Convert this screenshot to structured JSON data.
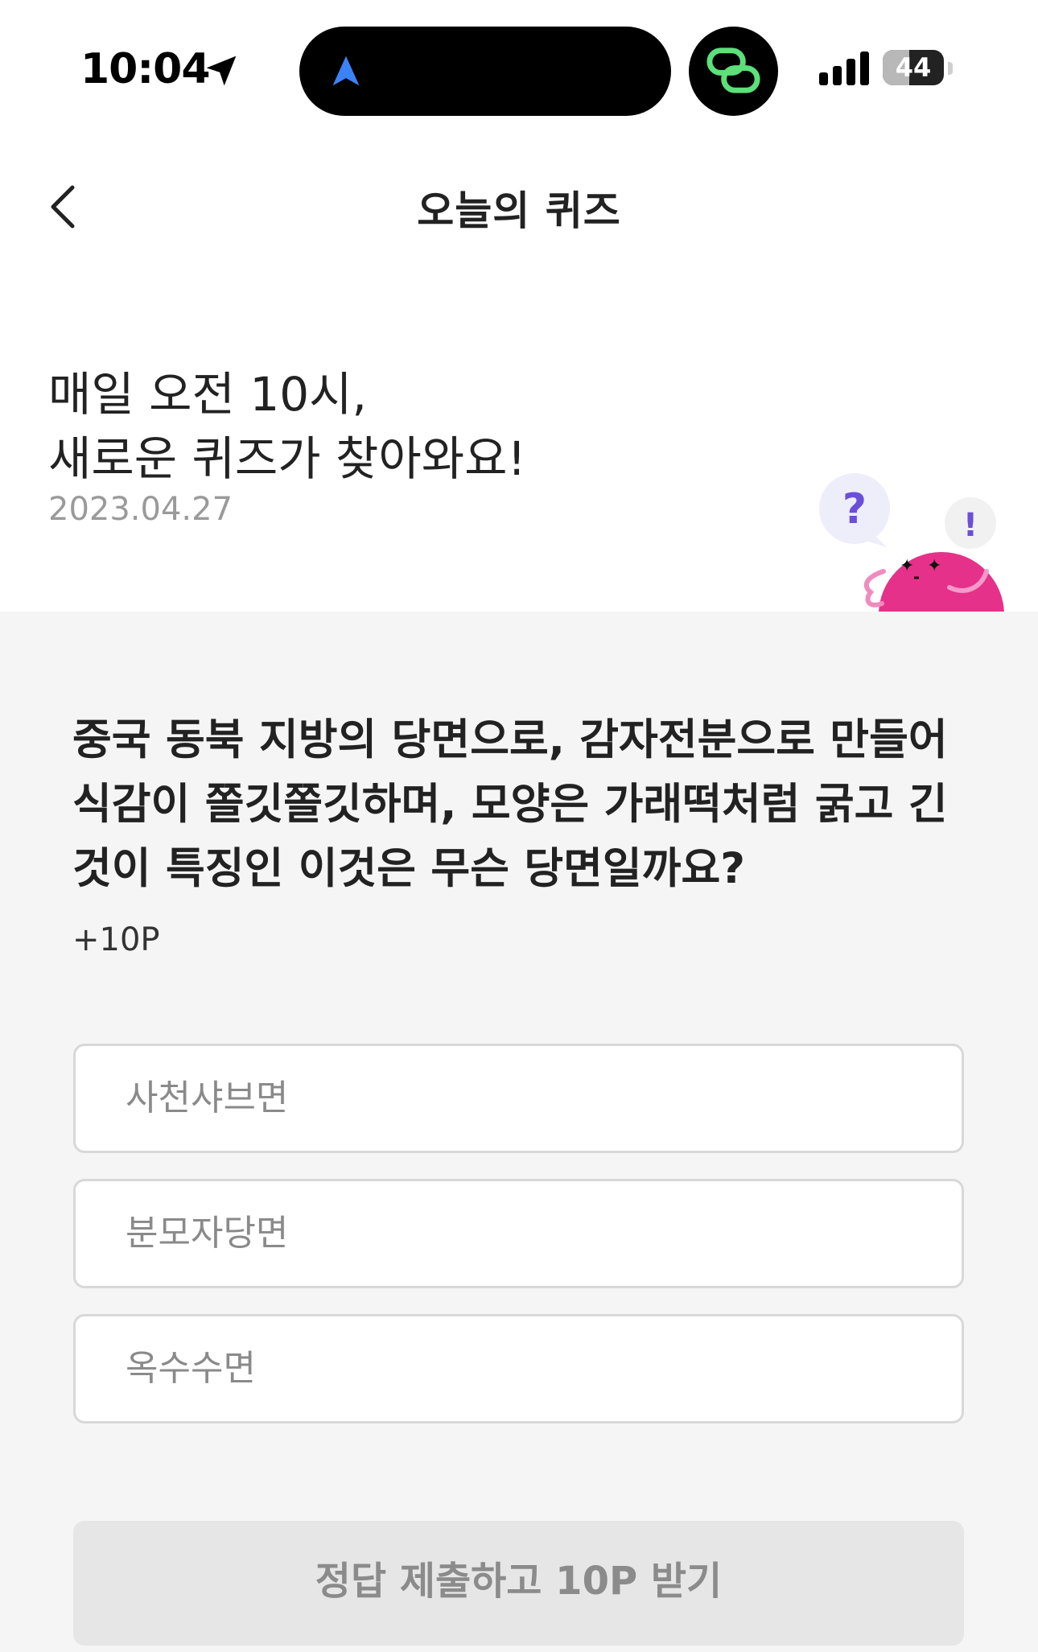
{
  "status_bar": {
    "time": "10:04",
    "battery": "44",
    "battery_level": 0.44,
    "icons": [
      "location-arrow-icon",
      "navigation-icon",
      "link-app-icon",
      "signal-icon",
      "battery-icon"
    ]
  },
  "header": {
    "title": "오늘의 퀴즈",
    "back_icon": "chevron-left-icon"
  },
  "intro": {
    "line1": "매일 오전 10시,",
    "line2": "새로운 퀴즈가 찾아와요!",
    "date": "2023.04.27"
  },
  "mascot": {
    "bubble_left": "?",
    "bubble_right": "!",
    "color": "#e6318a"
  },
  "quiz": {
    "question_lines": [
      "중국 동북 지방의 당면으로, 감자전분으로 만들어",
      "식감이 쫄깃쫄깃하며, 모양은 가래떡처럼 굵고 긴",
      "것이 특징인 이것은 무슨 당면일까요?"
    ],
    "points": "+10P",
    "options": [
      {
        "label": "사천샤브면"
      },
      {
        "label": "분모자당면"
      },
      {
        "label": "옥수수면"
      }
    ],
    "submit_label": "정답 제출하고 10P 받기"
  },
  "colors": {
    "accent_green": "#5be07a",
    "nav_blue": "#3b82f6",
    "question_mark_purple": "#6b4fd6",
    "mascot_pink": "#e6318a"
  }
}
